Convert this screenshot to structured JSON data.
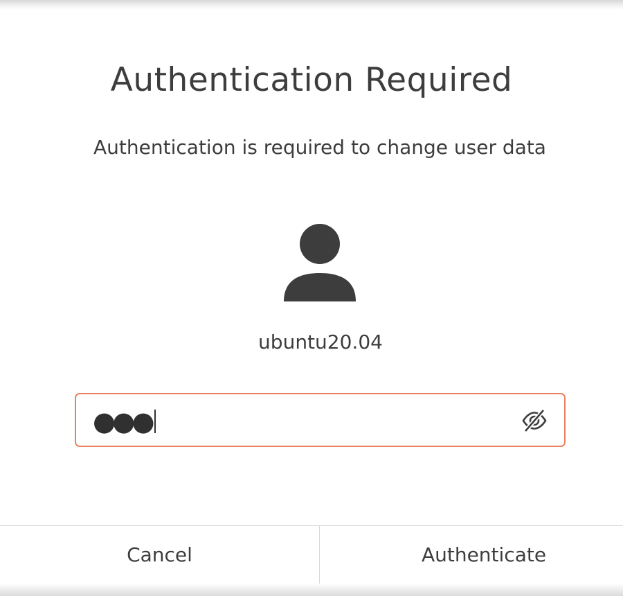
{
  "dialog": {
    "title": "Authentication Required",
    "message": "Authentication is required to change user data",
    "user": {
      "avatar_icon": "user-avatar-icon",
      "name": "ubuntu20.04"
    },
    "password": {
      "value": "●●●",
      "toggle_icon": "eye-slash-icon"
    },
    "buttons": {
      "cancel": "Cancel",
      "authenticate": "Authenticate"
    }
  },
  "colors": {
    "text": "#3d3d3d",
    "focus_border": "#e9825d",
    "divider": "#d8d8d8"
  }
}
